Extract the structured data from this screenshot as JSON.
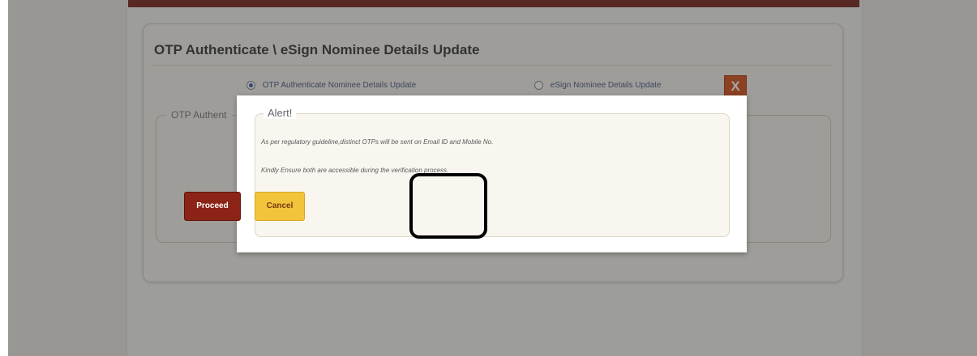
{
  "page": {
    "title": "OTP Authenticate \\ eSign Nominee Details Update",
    "radio_options": [
      {
        "label": "OTP Authenticate Nominee Details Update",
        "checked": true
      },
      {
        "label": "eSign Nominee Details Update",
        "checked": false
      }
    ],
    "close_label": "X",
    "inner_legend": "OTP Authent"
  },
  "modal": {
    "legend": "Alert!",
    "message_line1": "As per regulatory guideline,distinct OTPs will be sent on Email ID and Mobile No.",
    "message_line2": "Kindly Ensure both are accessible during the verification process.",
    "proceed_label": "Proceed",
    "cancel_label": "Cancel"
  },
  "colors": {
    "brand_dark": "#7a2a20",
    "proceed": "#8b2417",
    "cancel": "#f2c43c",
    "close": "#d4541e"
  },
  "icons": {
    "close": "close-icon",
    "radio": "radio-icon"
  }
}
